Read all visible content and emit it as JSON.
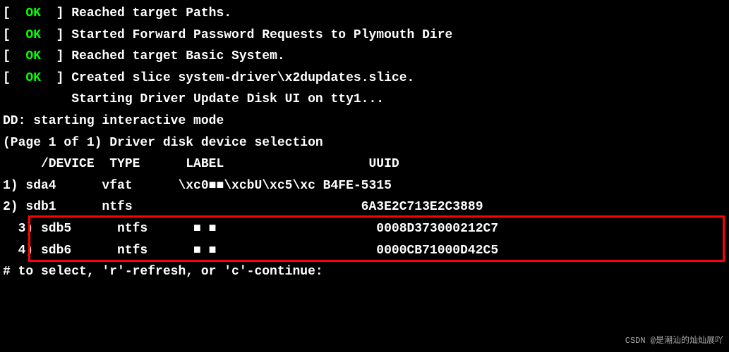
{
  "boot": {
    "l1_open": "[  ",
    "l1_ok": "OK",
    "l1_rest": "  ] Reached target Paths.",
    "l2_open": "[  ",
    "l2_ok": "OK",
    "l2_rest": "  ] Started Forward Password Requests to Plymouth Dire",
    "l3_open": "[  ",
    "l3_ok": "OK",
    "l3_rest": "  ] Reached target Basic System.",
    "l4_open": "[  ",
    "l4_ok": "OK",
    "l4_rest": "  ] Created slice system-driver\\x2dupdates.slice.",
    "l5": "         Starting Driver Update Disk UI on tty1...",
    "l6": "DD: starting interactive mode",
    "l7": "",
    "l8": "(Page 1 of 1) Driver disk device selection",
    "header": "     /DEVICE  TYPE      LABEL                   UUID",
    "r1": "1) sda4      vfat      \\xc0■■\\xcbU\\xc5\\xc B4FE-5315",
    "r2": "2) sdb1      ntfs                              6A3E2C713E2C3889",
    "r3": "  3) sdb5      ntfs      ■ ■                     0008D373000212C7",
    "r4": "  4) sdb6      ntfs      ■ ■                     0000CB71000D42C5",
    "prompt": "# to select, 'r'-refresh, or 'c'-continue:"
  },
  "watermark": "CSDN @是潮汕的灿灿展吖"
}
